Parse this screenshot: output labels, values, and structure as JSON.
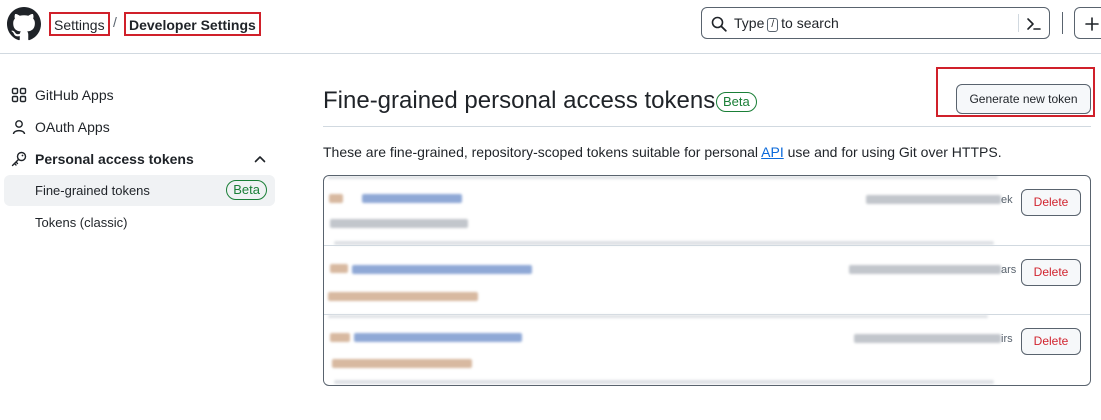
{
  "header": {
    "breadcrumb": {
      "settings": "Settings",
      "separator": "/",
      "current": "Developer Settings"
    },
    "search": {
      "prefix": "Type",
      "key": "/",
      "suffix": "to search"
    }
  },
  "sidebar": {
    "items": [
      {
        "label": "GitHub Apps",
        "icon": "apps-icon"
      },
      {
        "label": "OAuth Apps",
        "icon": "person-icon"
      },
      {
        "label": "Personal access tokens",
        "icon": "key-icon"
      }
    ],
    "subitems": [
      {
        "label": "Fine-grained tokens",
        "badge": "Beta",
        "active": true
      },
      {
        "label": "Tokens (classic)",
        "active": false
      }
    ]
  },
  "main": {
    "title": "Fine-grained personal access tokens",
    "title_badge": "Beta",
    "generate_button": "Generate new token",
    "description": {
      "before": "These are fine-grained, repository-scoped tokens suitable for personal ",
      "link": "API",
      "after": " use and for using Git over HTTPS."
    },
    "tokens": [
      {
        "expiry_visible_tail": "ek",
        "delete_label": "Delete"
      },
      {
        "expiry_visible_tail": "ars",
        "delete_label": "Delete"
      },
      {
        "expiry_visible_tail": "irs",
        "delete_label": "Delete"
      }
    ]
  },
  "colors": {
    "accent_link": "#0969da",
    "beta_green": "#1a7f37",
    "danger_red": "#d1242f",
    "highlight_box": "#d0202a"
  }
}
